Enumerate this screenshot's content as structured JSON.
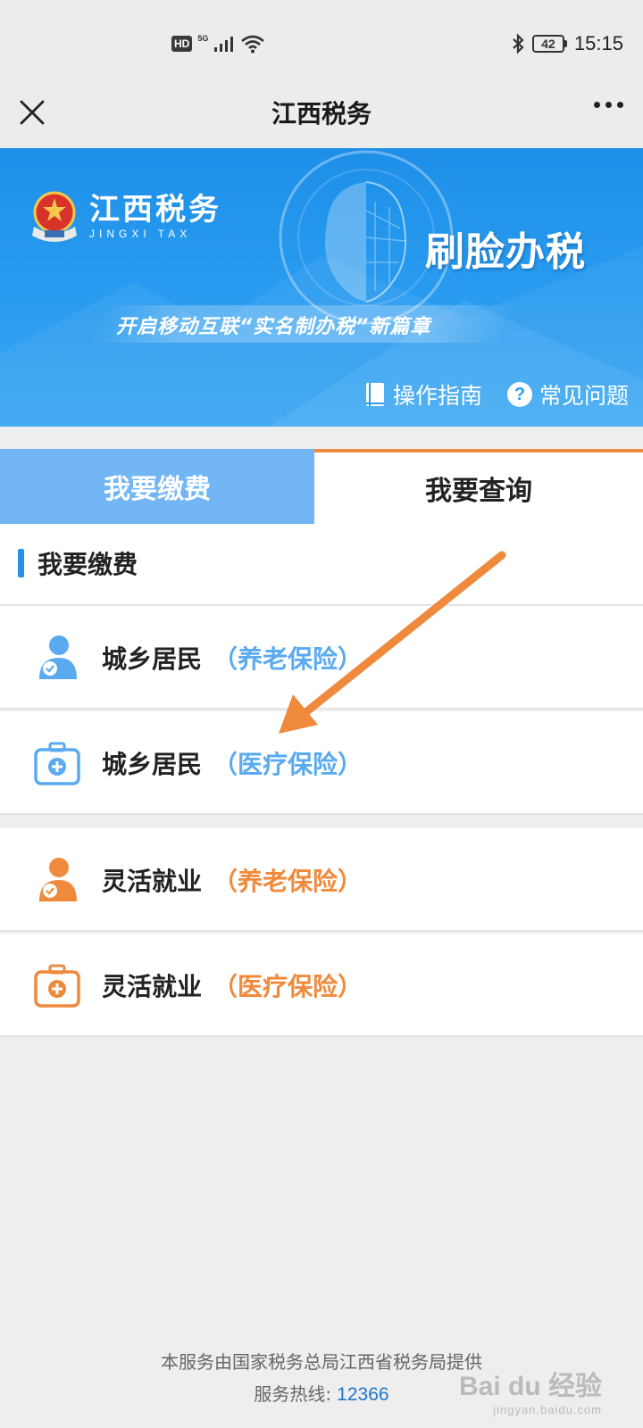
{
  "status_bar": {
    "hd": "HD",
    "signal": "5G",
    "battery": "42",
    "time": "15:15"
  },
  "nav": {
    "title": "江西税务"
  },
  "banner": {
    "brand_cn": "江西税务",
    "brand_en": "JINGXI TAX",
    "headline": "刷脸办税",
    "slogan": "开启移动互联“实名制办税”新篇章",
    "guide_label": "操作指南",
    "faq_label": "常见问题"
  },
  "tabs": [
    {
      "label": "我要缴费",
      "active": true
    },
    {
      "label": "我要查询",
      "active": false
    }
  ],
  "section": {
    "title": "我要缴费"
  },
  "items": [
    {
      "label": "城乡居民",
      "tag": "（养老保险）",
      "icon": "person-icon",
      "color": "#5aaaf0"
    },
    {
      "label": "城乡居民",
      "tag": "（医疗保险）",
      "icon": "medical-kit-icon",
      "color": "#5aaaf0"
    },
    {
      "label": "灵活就业",
      "tag": "（养老保险）",
      "icon": "person-icon",
      "color": "#ef8a3c"
    },
    {
      "label": "灵活就业",
      "tag": "（医疗保险）",
      "icon": "medical-kit-icon",
      "color": "#ef8a3c"
    }
  ],
  "footer": {
    "provider": "本服务由国家税务总局江西省税务局提供",
    "hotline_label": "服务热线:",
    "hotline_number": "12366"
  },
  "watermark": {
    "text": "Bai du 经验",
    "url": "jingyan.baidu.com"
  },
  "colors": {
    "banner_blue": "#2a9cf0",
    "active_tab": "#72b6f5",
    "accent_orange": "#ef8a3c",
    "tag_blue": "#5aaaf0"
  }
}
